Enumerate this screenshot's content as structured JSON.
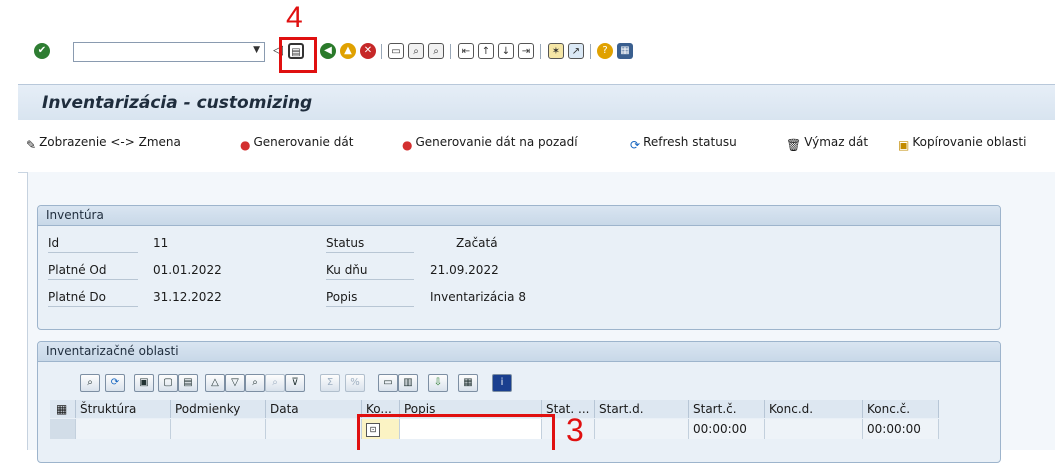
{
  "annotations": {
    "save_step": "4",
    "field_step": "3"
  },
  "toolbar": {
    "command_field_value": "",
    "icons": [
      "enter-icon",
      "save-icon",
      "back-icon",
      "exit-icon",
      "cancel-icon",
      "print-icon",
      "find-icon",
      "find-next-icon",
      "first-page-icon",
      "previous-page-icon",
      "next-page-icon",
      "last-page-icon",
      "new-session-icon",
      "shortcut-icon",
      "help-icon",
      "layout-icon"
    ]
  },
  "title": "Inventarizácia - customizing",
  "app_toolbar": {
    "toggle": "Zobrazenie <-> Zmena",
    "generate": "Generovanie dát",
    "generate_bg": "Generovanie dát na pozadí",
    "refresh": "Refresh statusu",
    "delete": "Výmaz dát",
    "copy": "Kopírovanie oblasti"
  },
  "inventura": {
    "title": "Inventúra",
    "id_label": "Id",
    "id_value": "11",
    "from_label": "Platné Od",
    "from_value": "01.01.2022",
    "to_label": "Platné Do",
    "to_value": "31.12.2022",
    "status_label": "Status",
    "status_value": "Začatá",
    "date_label": "Ku dňu",
    "date_value": "21.09.2022",
    "desc_label": "Popis",
    "desc_value": "Inventarizácia 8"
  },
  "oblasti": {
    "title": "Inventarizačné oblasti",
    "columns": [
      "Štruktúra",
      "Podmienky",
      "Data",
      "Ko...",
      "Popis",
      "Stat. ...",
      "Start.d.",
      "Start.č.",
      "Konc.d.",
      "Konc.č."
    ],
    "row": {
      "start_time": "00:00:00",
      "end_time": "00:00:00"
    }
  },
  "colors": {
    "accent_red": "#e01010",
    "panel_blue": "#e9f0f7"
  }
}
